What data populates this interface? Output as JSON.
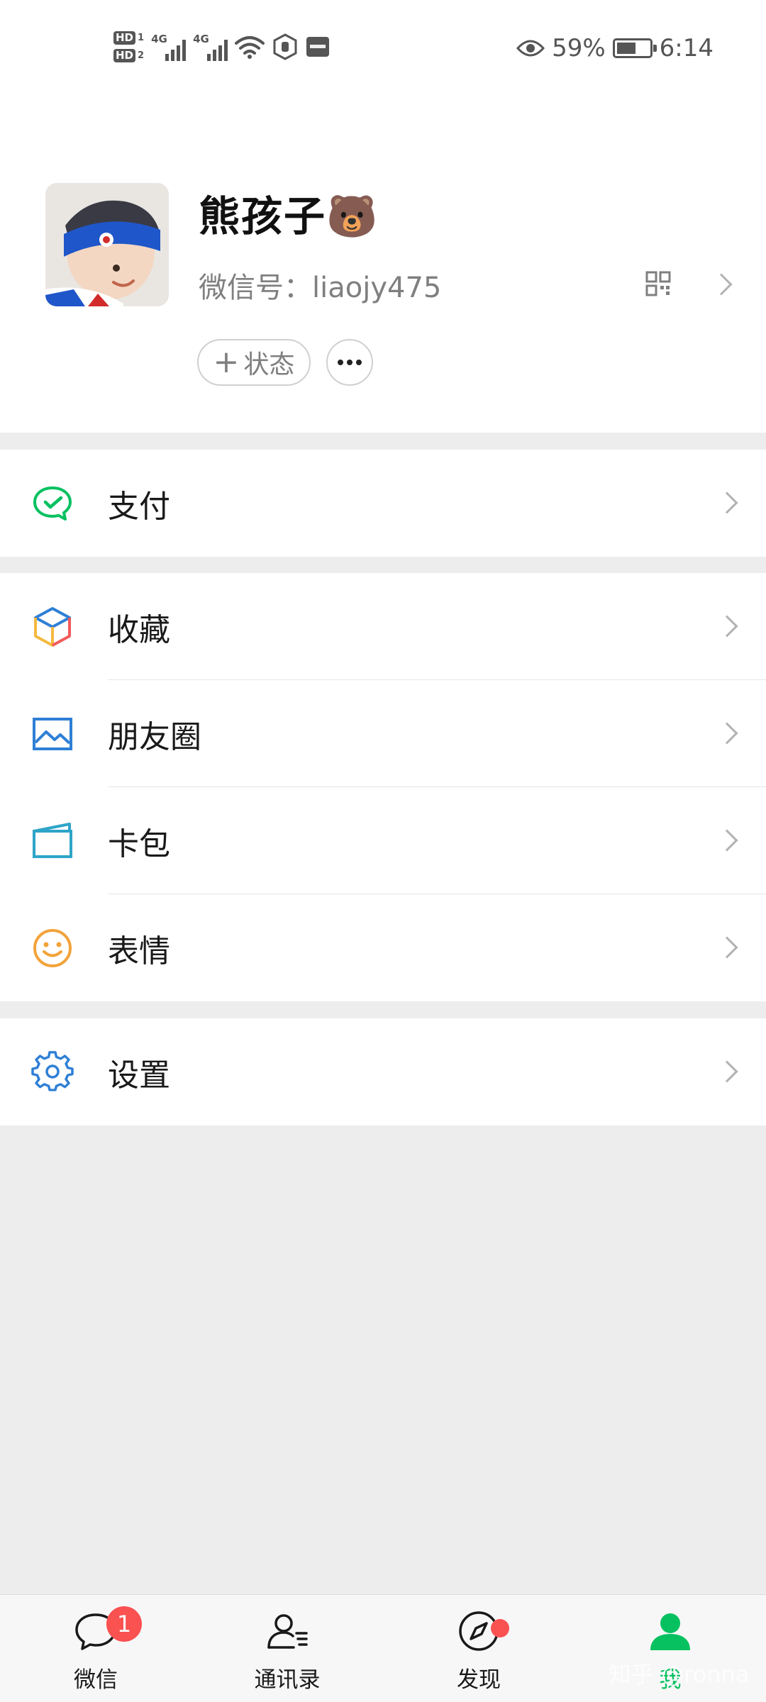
{
  "status_bar": {
    "hd1": "HD",
    "hd1_num": "1",
    "hd2": "HD",
    "hd2_num": "2",
    "sim1_type": "4G",
    "sim2_type": "4G",
    "wifi_icon": "wifi-icon",
    "battery_percent": "59%",
    "battery_level": 0.59,
    "time": "6:14"
  },
  "profile": {
    "nickname": "熊孩子",
    "nickname_emoji": "🐻",
    "wechat_id_label": "微信号：",
    "wechat_id": "liaojy475",
    "status_button_plus": "+",
    "status_button_label": "状态"
  },
  "menu": {
    "pay": "支付",
    "favorites": "收藏",
    "moments": "朋友圈",
    "cards": "卡包",
    "stickers": "表情",
    "settings": "设置"
  },
  "tabbar": {
    "chats": "微信",
    "chats_badge": "1",
    "contacts": "通讯录",
    "discover": "发现",
    "me": "我"
  },
  "watermark": "知乎 @ronna",
  "colors": {
    "accent_green": "#07c160",
    "badge_red": "#fa5151",
    "background": "#ededed"
  }
}
